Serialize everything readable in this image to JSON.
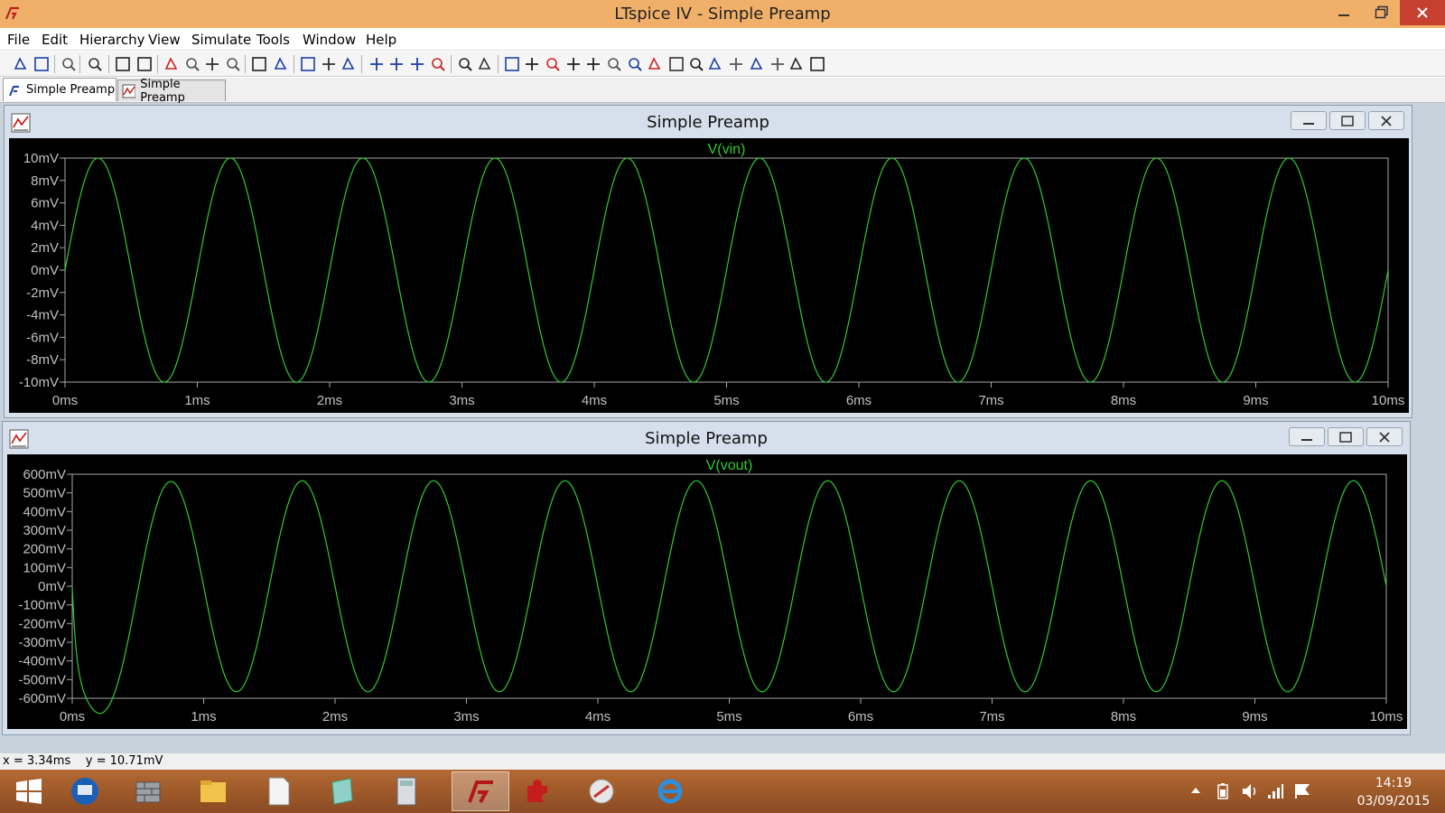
{
  "window": {
    "title": "LTspice IV - Simple Preamp"
  },
  "menu": [
    "File",
    "Edit",
    "Hierarchy",
    "View",
    "Simulate",
    "Tools",
    "Window",
    "Help"
  ],
  "toolbar_icons": [
    "new-schematic-icon",
    "open-icon",
    "save-icon",
    "control-panel-icon",
    "run-icon",
    "halt-icon",
    "zoom-in-icon",
    "zoom-full-icon",
    "zoom-out-icon",
    "zoom-cancel-icon",
    "autorange-icon",
    "grid-icon",
    "tile-horizontal-icon",
    "tile-vertical-icon",
    "cascade-icon",
    "cut-icon",
    "copy-icon",
    "paste-icon",
    "find-icon",
    "print-preview-icon",
    "print-icon",
    "wire-icon",
    "ground-icon",
    "label-net-icon",
    "resistor-icon",
    "capacitor-icon",
    "inductor-icon",
    "diode-icon",
    "component-icon",
    "move-icon",
    "drag-icon",
    "undo-icon",
    "redo-icon",
    "rotate-icon",
    "mirror-icon",
    "text-icon",
    "spice-directive-icon"
  ],
  "tabs": [
    {
      "label": "Simple Preamp",
      "icon": "schematic-icon",
      "active": true
    },
    {
      "label": "Simple Preamp",
      "icon": "waveform-icon",
      "active": false
    }
  ],
  "plots": [
    {
      "title": "Simple Preamp",
      "trace": "V(vin)"
    },
    {
      "title": "Simple Preamp",
      "trace": "V(vout)"
    }
  ],
  "status": {
    "text": "x = 3.34ms    y = 10.71mV"
  },
  "taskbar": {
    "apps": [
      "start-icon",
      "remote-desktop-icon",
      "firewall-icon",
      "file-explorer-icon",
      "notepad-icon",
      "notebook-icon",
      "calculator-icon",
      "ltspice-icon",
      "puzzle-icon",
      "snipping-tool-icon",
      "internet-explorer-icon"
    ],
    "time": "14:19",
    "date": "03/09/2015"
  },
  "colors": {
    "trace": "#2ecc2e",
    "plot_bg": "#000000",
    "axis": "#a8a8a8",
    "titlebar": "#f0b06a",
    "close": "#c7402f"
  },
  "chart_data": [
    {
      "type": "line",
      "title": "Simple Preamp",
      "series": [
        {
          "name": "V(vin)",
          "waveform": "sine",
          "amplitude": 10,
          "frequency_khz": 1,
          "phase_deg": 0
        }
      ],
      "xlabel": "",
      "ylabel": "",
      "x_ticks": [
        "0ms",
        "1ms",
        "2ms",
        "3ms",
        "4ms",
        "5ms",
        "6ms",
        "7ms",
        "8ms",
        "9ms",
        "10ms"
      ],
      "y_ticks": [
        "10mV",
        "8mV",
        "6mV",
        "4mV",
        "2mV",
        "0mV",
        "-2mV",
        "-4mV",
        "-6mV",
        "-8mV",
        "-10mV"
      ],
      "xlim": [
        0,
        10
      ],
      "ylim": [
        -10,
        10
      ],
      "grid": false
    },
    {
      "type": "line",
      "title": "Simple Preamp",
      "series": [
        {
          "name": "V(vout)",
          "waveform": "sine",
          "amplitude": 565,
          "frequency_khz": 1,
          "phase_deg": 180,
          "initial_offset": -545,
          "offset_decay_ms": 0.15
        }
      ],
      "xlabel": "",
      "ylabel": "",
      "x_ticks": [
        "0ms",
        "1ms",
        "2ms",
        "3ms",
        "4ms",
        "5ms",
        "6ms",
        "7ms",
        "8ms",
        "9ms",
        "10ms"
      ],
      "y_ticks": [
        "600mV",
        "500mV",
        "400mV",
        "300mV",
        "200mV",
        "100mV",
        "0mV",
        "-100mV",
        "-200mV",
        "-300mV",
        "-400mV",
        "-500mV",
        "-600mV"
      ],
      "xlim": [
        0,
        10
      ],
      "ylim": [
        -600,
        600
      ],
      "grid": false
    }
  ]
}
